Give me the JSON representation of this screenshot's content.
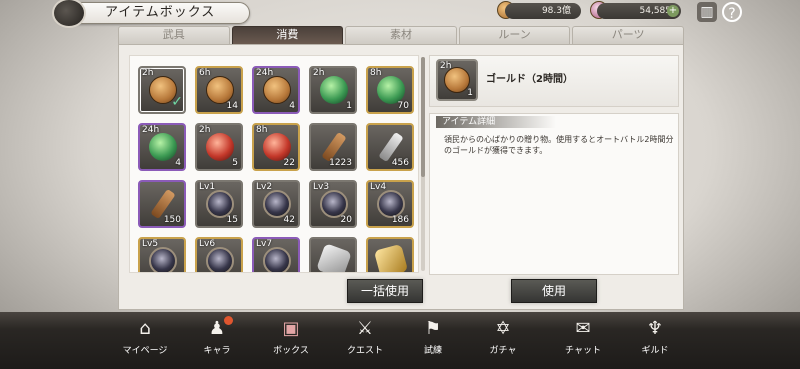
{
  "header": {
    "title": "アイテムボックス",
    "gold_amount": "98.3億",
    "gem_amount": "54,585",
    "back_icon": "back-orb-icon",
    "plus_icon": "plus-icon",
    "inventory_icon": "inventory-icon",
    "help_icon": "help-icon"
  },
  "tabs": [
    {
      "label": "武具",
      "active": false
    },
    {
      "label": "消費",
      "active": true
    },
    {
      "label": "素材",
      "active": false
    },
    {
      "label": "ルーン",
      "active": false
    },
    {
      "label": "パーツ",
      "active": false
    }
  ],
  "items": [
    {
      "tag": "2h",
      "count": "",
      "icon": "coin",
      "frame": "default",
      "selected": true
    },
    {
      "tag": "6h",
      "count": "14",
      "icon": "coin",
      "frame": "gold",
      "selected": false
    },
    {
      "tag": "24h",
      "count": "4",
      "icon": "coin",
      "frame": "purple",
      "selected": false
    },
    {
      "tag": "2h",
      "count": "1",
      "icon": "orb-green",
      "frame": "default",
      "selected": false
    },
    {
      "tag": "8h",
      "count": "70",
      "icon": "orb-green",
      "frame": "gold",
      "selected": false
    },
    {
      "tag": "24h",
      "count": "4",
      "icon": "orb-green",
      "frame": "purple",
      "selected": false
    },
    {
      "tag": "2h",
      "count": "5",
      "icon": "orb-red",
      "frame": "default",
      "selected": false
    },
    {
      "tag": "8h",
      "count": "22",
      "icon": "orb-red",
      "frame": "gold",
      "selected": false
    },
    {
      "tag": "",
      "count": "1223",
      "icon": "key-bronze",
      "frame": "default",
      "selected": false
    },
    {
      "tag": "",
      "count": "456",
      "icon": "key-silver",
      "frame": "gold",
      "selected": false
    },
    {
      "tag": "",
      "count": "150",
      "icon": "key-bronze",
      "frame": "purple",
      "selected": false
    },
    {
      "tag": "Lv1",
      "count": "15",
      "icon": "emblem",
      "frame": "default",
      "selected": false
    },
    {
      "tag": "Lv2",
      "count": "42",
      "icon": "emblem",
      "frame": "default",
      "selected": false
    },
    {
      "tag": "Lv3",
      "count": "20",
      "icon": "emblem",
      "frame": "default",
      "selected": false
    },
    {
      "tag": "Lv4",
      "count": "186",
      "icon": "emblem",
      "frame": "gold",
      "selected": false
    },
    {
      "tag": "Lv5",
      "count": "",
      "icon": "emblem",
      "frame": "gold",
      "selected": false
    },
    {
      "tag": "Lv6",
      "count": "",
      "icon": "emblem",
      "frame": "gold",
      "selected": false
    },
    {
      "tag": "Lv7",
      "count": "",
      "icon": "emblem",
      "frame": "purple",
      "selected": false
    },
    {
      "tag": "",
      "count": "",
      "icon": "shard-silver",
      "frame": "default",
      "selected": false
    },
    {
      "tag": "",
      "count": "",
      "icon": "shard-gold",
      "frame": "gold",
      "selected": false
    }
  ],
  "detail": {
    "tag": "2h",
    "count": "1",
    "name": "ゴールド（2時間）",
    "section_label": "アイテム詳細",
    "description": "領民からの心ばかりの贈り物。使用するとオートバトル2時間分のゴールドが獲得できます。"
  },
  "buttons": {
    "bulk_use": "一括使用",
    "use": "使用"
  },
  "nav": [
    {
      "label": "マイページ",
      "icon": "house-icon",
      "glyph": "⌂",
      "active": false,
      "badge": false
    },
    {
      "label": "キャラ",
      "icon": "characters-icon",
      "glyph": "♟",
      "active": false,
      "badge": true
    },
    {
      "label": "ボックス",
      "icon": "box-icon",
      "glyph": "▣",
      "active": true,
      "badge": false
    },
    {
      "label": "クエスト",
      "icon": "crossed-swords-icon",
      "glyph": "⚔",
      "active": false,
      "badge": false
    },
    {
      "label": "試練",
      "icon": "flag-icon",
      "glyph": "⚑",
      "active": false,
      "badge": false
    },
    {
      "label": "ガチャ",
      "icon": "magic-circle-icon",
      "glyph": "✡",
      "active": false,
      "badge": false
    },
    {
      "label": "チャット",
      "icon": "chat-icon",
      "glyph": "✉",
      "active": false,
      "badge": false
    },
    {
      "label": "ギルド",
      "icon": "guild-crest-icon",
      "glyph": "♆",
      "active": false,
      "badge": false
    }
  ]
}
